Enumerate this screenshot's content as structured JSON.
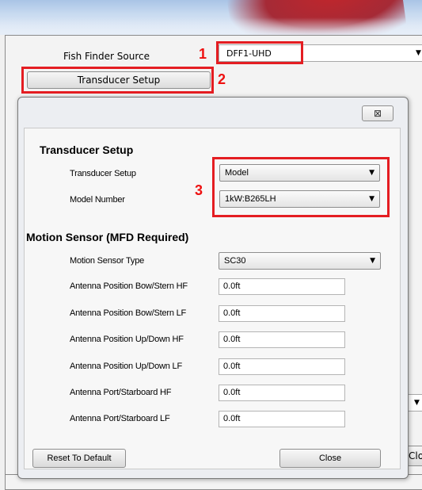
{
  "background": {
    "fish_finder_source_label": "Fish Finder Source",
    "fish_finder_source_value": "DFF1-UHD",
    "transducer_setup_button": "Transducer Setup",
    "right_button_fragment": "Clo"
  },
  "dialog": {
    "close_glyph": "⊠",
    "transducer_section": {
      "title": "Transducer Setup",
      "fields": [
        {
          "label": "Transducer Setup",
          "value": "Model"
        },
        {
          "label": "Model Number",
          "value": "1kW:B265LH"
        }
      ]
    },
    "motion_section": {
      "title": "Motion Sensor (MFD Required)",
      "type_label": "Motion Sensor Type",
      "type_value": "SC30",
      "fields": [
        {
          "label": "Antenna Position Bow/Stern HF",
          "value": "0.0ft"
        },
        {
          "label": "Antenna Position Bow/Stern LF",
          "value": "0.0ft"
        },
        {
          "label": "Antenna Position Up/Down HF",
          "value": "0.0ft"
        },
        {
          "label": "Antenna Position Up/Down LF",
          "value": "0.0ft"
        },
        {
          "label": "Antenna Port/Starboard HF",
          "value": "0.0ft"
        },
        {
          "label": "Antenna Port/Starboard LF",
          "value": "0.0ft"
        }
      ]
    },
    "reset_button": "Reset To Default",
    "close_button": "Close"
  },
  "annotations": {
    "marker_1": "1",
    "marker_2": "2",
    "marker_3": "3",
    "highlight_color": "#e41d22"
  }
}
